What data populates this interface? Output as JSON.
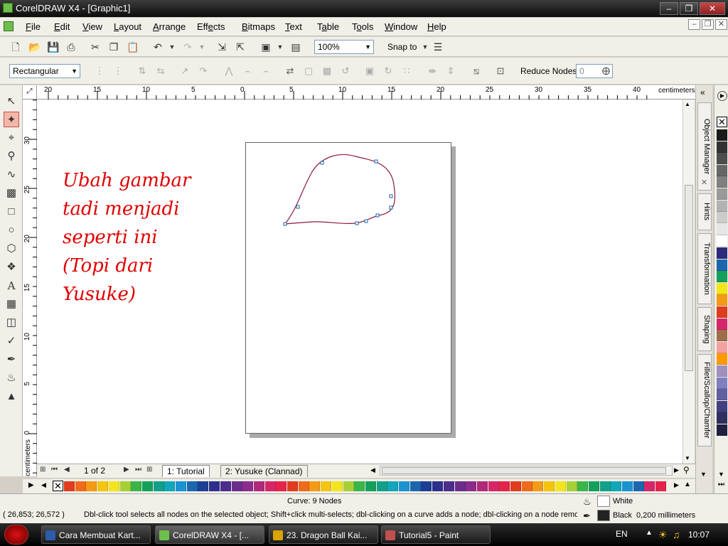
{
  "window": {
    "title": "CorelDRAW X4 - [Graphic1]"
  },
  "menu": {
    "items": [
      {
        "label": "File",
        "key": "F",
        "rest": "ile"
      },
      {
        "label": "Edit",
        "key": "E",
        "rest": "dit"
      },
      {
        "label": "View",
        "key": "V",
        "rest": "iew"
      },
      {
        "label": "Layout",
        "key": "L",
        "rest": "ayout"
      },
      {
        "label": "Arrange",
        "key": "A",
        "rest": "rrange"
      },
      {
        "label": "Effects",
        "pre": "Eff",
        "key": "e",
        "rest": "cts"
      },
      {
        "label": "Bitmaps",
        "key": "B",
        "rest": "itmaps"
      },
      {
        "label": "Text",
        "key": "T",
        "rest": "ext"
      },
      {
        "label": "Table",
        "pre": "T",
        "key": "a",
        "rest": "ble"
      },
      {
        "label": "Tools",
        "pre": "T",
        "key": "o",
        "rest": "ols"
      },
      {
        "label": "Window",
        "key": "W",
        "rest": "indow"
      },
      {
        "label": "Help",
        "key": "H",
        "rest": "elp"
      }
    ]
  },
  "standard_toolbar": {
    "zoom": "100%",
    "snap_to": "Snap to"
  },
  "property_bar": {
    "selection_mode": "Rectangular",
    "reduce_nodes_label": "Reduce Nodes",
    "reduce_nodes_value": "0"
  },
  "rulers": {
    "unit": "centimeters",
    "horizontal_labels": [
      "20",
      "15",
      "10",
      "5",
      "0",
      "5",
      "10",
      "15",
      "20",
      "25",
      "30",
      "35",
      "40"
    ],
    "vertical_labels": [
      "30",
      "25",
      "20",
      "15",
      "10",
      "5",
      "0"
    ],
    "vertical_unit": "centimeters"
  },
  "annotation": {
    "lines": [
      "Ubah gambar",
      "tadi menjadi",
      "seperti ini",
      "(Topi dari",
      "Yusuke)"
    ],
    "color": "#e00000"
  },
  "document_navigator": {
    "page_counter": "1 of 2",
    "tabs": [
      "1: Tutorial",
      "2: Yusuke (Clannad)"
    ]
  },
  "dockers": {
    "tabs": [
      "Object Manager",
      "Hints",
      "Transformation",
      "Shaping",
      "Fillet/Scallop/Chamfer"
    ]
  },
  "status": {
    "object_info": "Curve: 9 Nodes",
    "coordinates": "( 26,853; 26,572 )",
    "hint": "Dbl-click tool selects all nodes on the selected object; Shift+click multi-selects; dbl-clicking on a curve adds a node; dbl-clicking on a node remo...",
    "fill_label": "White",
    "outline_label": "Black  0,200 millimeters"
  },
  "taskbar": {
    "buttons": [
      {
        "label": "Cara Membuat Kart...",
        "icon": "word-icon",
        "color": "#2a5caa"
      },
      {
        "label": "CorelDRAW X4 - [...",
        "icon": "coreldraw-icon",
        "color": "#6cc04a",
        "active": true
      },
      {
        "label": "23. Dragon Ball Kai...",
        "icon": "pencil-icon",
        "color": "#d9a300"
      },
      {
        "label": "Tutorial5 - Paint",
        "icon": "paint-icon",
        "color": "#c05050"
      }
    ],
    "language": "EN",
    "clock": "10:07"
  },
  "colors": {
    "palette_bottom": [
      "#e03c1e",
      "#ef6a1a",
      "#f39a16",
      "#f5c40e",
      "#f3e51b",
      "#a9cf37",
      "#39b54a",
      "#14a05a",
      "#12a08a",
      "#11a6b9",
      "#1b93d2",
      "#1c66b0",
      "#1c3f94",
      "#2c2f8c",
      "#4c2c8c",
      "#6b2c8c",
      "#8b2c8c",
      "#b0287a",
      "#d6266a",
      "#e5234a",
      "#e03c1e",
      "#ef6a1a",
      "#f39a16",
      "#f5c40e",
      "#f3e51b",
      "#a9cf37",
      "#39b54a",
      "#14a05a",
      "#12a08a",
      "#11a6b9",
      "#1b93d2",
      "#1c66b0",
      "#1c3f94",
      "#2c2f8c",
      "#4c2c8c",
      "#6b2c8c",
      "#8b2c8c",
      "#b0287a",
      "#d6266a",
      "#e5234a",
      "#e03c1e",
      "#ef6a1a",
      "#f39a16",
      "#f5c40e",
      "#f3e51b",
      "#a9cf37",
      "#39b54a",
      "#14a05a",
      "#12a08a",
      "#11a6b9",
      "#1b93d2",
      "#1c66b0",
      "#d6266a",
      "#e5234a"
    ],
    "palette_right": [
      "#1a1a1a",
      "#333333",
      "#4d4d4d",
      "#666666",
      "#808080",
      "#999999",
      "#b3b3b3",
      "#cccccc",
      "#e6e6e6",
      "#ffffff",
      "#2e2a7a",
      "#1c66b0",
      "#14a05a",
      "#f3e51b",
      "#f39a16",
      "#e03c1e",
      "#d6266a",
      "#9c6e4a",
      "#f5a0a0",
      "#ff9900",
      "#a090c0",
      "#8080c0",
      "#6060a0",
      "#404080",
      "#303060",
      "#202040"
    ]
  }
}
